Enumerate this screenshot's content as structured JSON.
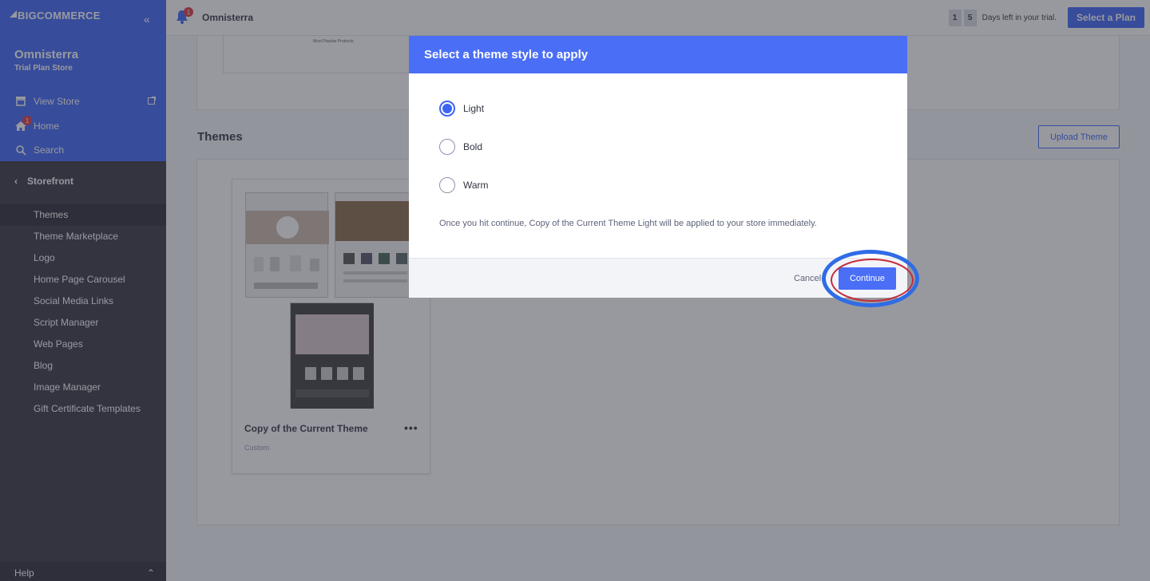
{
  "sidebar": {
    "brand": "BIGCOMMERCE",
    "store_name": "Omnisterra",
    "store_plan": "Trial Plan Store",
    "top_links": [
      {
        "label": "View Store",
        "icon": "store-icon"
      },
      {
        "label": "Home",
        "icon": "home-icon",
        "badge": "1"
      },
      {
        "label": "Search",
        "icon": "search-icon"
      }
    ],
    "section": "Storefront",
    "items": [
      {
        "label": "Themes",
        "active": true
      },
      {
        "label": "Theme Marketplace"
      },
      {
        "label": "Logo"
      },
      {
        "label": "Home Page Carousel"
      },
      {
        "label": "Social Media Links"
      },
      {
        "label": "Script Manager"
      },
      {
        "label": "Web Pages"
      },
      {
        "label": "Blog"
      },
      {
        "label": "Image Manager"
      },
      {
        "label": "Gift Certificate Templates"
      }
    ],
    "help": "Help"
  },
  "header": {
    "notification_count": "1",
    "store": "Omnisterra",
    "days_digits": [
      "1",
      "5"
    ],
    "days_text": "Days left in your trial.",
    "plan_button": "Select a Plan"
  },
  "main": {
    "chart_title": "Most Popular Products",
    "themes_title": "Themes",
    "upload_button": "Upload Theme",
    "theme_card": {
      "name": "Copy of the Current Theme",
      "tag": "Custom",
      "menu": "•••"
    }
  },
  "modal": {
    "title": "Select a theme style to apply",
    "options": [
      {
        "label": "Light",
        "checked": true
      },
      {
        "label": "Bold",
        "checked": false
      },
      {
        "label": "Warm",
        "checked": false
      }
    ],
    "notice": "Once you hit continue, Copy of the Current Theme Light will be applied to your store immediately.",
    "cancel": "Cancel",
    "continue": "Continue"
  },
  "colors": {
    "accent": "#3c64f4",
    "sidebar": "#34343f",
    "badge": "#db3643",
    "highlight_ring": "#2f6ce5"
  }
}
